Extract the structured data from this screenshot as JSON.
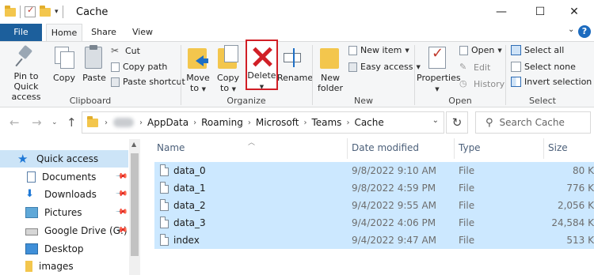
{
  "window": {
    "title": "Cache",
    "minimize_icon": "—",
    "maximize_icon": "☐",
    "close_icon": "✕"
  },
  "ribbon_tabs": [
    "File",
    "Home",
    "Share",
    "View"
  ],
  "help_label": "?",
  "ribbon": {
    "clipboard": {
      "group_label": "Clipboard",
      "pin_label_line1": "Pin to Quick",
      "pin_label_line2": "access",
      "copy_label": "Copy",
      "paste_label": "Paste",
      "cut_label": "Cut",
      "copy_path_label": "Copy path",
      "paste_shortcut_label": "Paste shortcut"
    },
    "organize": {
      "group_label": "Organize",
      "move_to_line1": "Move",
      "move_to_line2": "to",
      "copy_to_line1": "Copy",
      "copy_to_line2": "to",
      "delete_label": "Delete",
      "rename_label": "Rename"
    },
    "new": {
      "group_label": "New",
      "new_folder_line1": "New",
      "new_folder_line2": "folder",
      "new_item_label": "New item",
      "easy_access_label": "Easy access"
    },
    "open": {
      "group_label": "Open",
      "properties_label": "Properties",
      "open_label": "Open",
      "edit_label": "Edit",
      "history_label": "History"
    },
    "select": {
      "group_label": "Select",
      "select_all_label": "Select all",
      "select_none_label": "Select none",
      "invert_selection_label": "Invert selection"
    }
  },
  "address": {
    "crumbs": [
      "AppData",
      "Roaming",
      "Microsoft",
      "Teams",
      "Cache"
    ],
    "search_placeholder": "Search Cache"
  },
  "nav_pane": {
    "items": [
      {
        "label": "Quick access",
        "icon": "star-icon",
        "pinned": false
      },
      {
        "label": "Documents",
        "icon": "documents-icon",
        "pinned": true
      },
      {
        "label": "Downloads",
        "icon": "downloads-icon",
        "pinned": true
      },
      {
        "label": "Pictures",
        "icon": "pictures-icon",
        "pinned": true
      },
      {
        "label": "Google Drive (G:)",
        "icon": "drive-icon",
        "pinned": true
      },
      {
        "label": "Desktop",
        "icon": "desktop-icon",
        "pinned": false
      },
      {
        "label": "images",
        "icon": "folder-icon",
        "pinned": false
      }
    ]
  },
  "file_list": {
    "columns": [
      "Name",
      "Date modified",
      "Type",
      "Size"
    ],
    "rows": [
      {
        "name": "data_0",
        "date": "9/8/2022 9:10 AM",
        "type": "File",
        "size": "80 K"
      },
      {
        "name": "data_1",
        "date": "9/8/2022 4:59 PM",
        "type": "File",
        "size": "776 K"
      },
      {
        "name": "data_2",
        "date": "9/4/2022 9:55 AM",
        "type": "File",
        "size": "2,056 K"
      },
      {
        "name": "data_3",
        "date": "9/4/2022 4:06 PM",
        "type": "File",
        "size": "24,584 K"
      },
      {
        "name": "index",
        "date": "9/4/2022 9:47 AM",
        "type": "File",
        "size": "513 K"
      }
    ]
  },
  "colors": {
    "file_tab": "#1c5f9c",
    "selection": "#cce8ff",
    "delete_highlight": "#d11f26"
  }
}
